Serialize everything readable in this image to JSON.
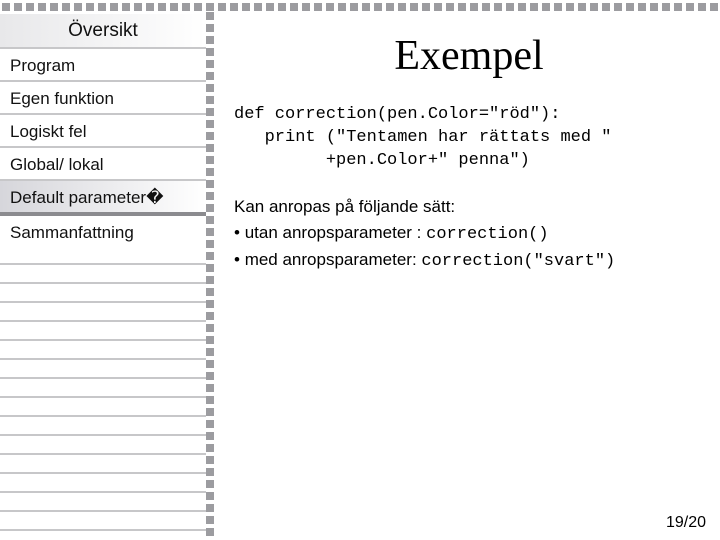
{
  "sidebar": {
    "items": [
      {
        "label": "Översikt",
        "kind": "heading"
      },
      {
        "label": "Program"
      },
      {
        "label": "Egen funktion"
      },
      {
        "label": "Logiskt fel"
      },
      {
        "label": "Global/ lokal"
      },
      {
        "label": "Default parameter�",
        "active": true
      },
      {
        "label": "Sammanfattning",
        "strongDivider": true
      }
    ]
  },
  "main": {
    "title": "Exempel",
    "code": "def correction(pen.Color=\"röd\"):\n   print (\"Tentamen har rättats med \"\n         +pen.Color+\" penna\")",
    "body": {
      "intro": "Kan anropas på följande sätt:",
      "bullets": [
        {
          "text": "utan anropsparameter : ",
          "code": "correction()"
        },
        {
          "text": "med anropsparameter: ",
          "code": "correction(\"svart\")"
        }
      ]
    }
  },
  "pagenum": "19/20",
  "decor": {
    "topCount": 60,
    "vertCount": 44
  }
}
